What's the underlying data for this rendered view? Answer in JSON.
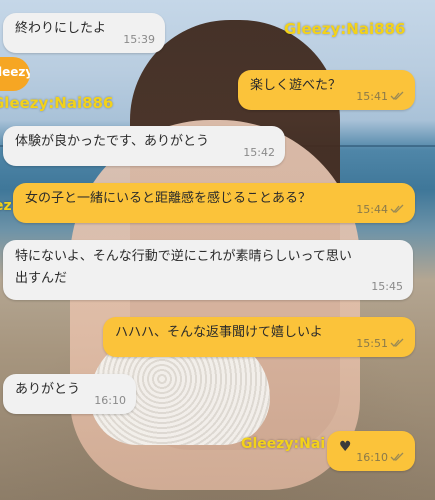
{
  "watermark": {
    "text": "Gleezy:Nai886",
    "partial": "Gleezy:Nai",
    "logo": "leezy",
    "side": "ez"
  },
  "messages": [
    {
      "dir": "in",
      "text": "終わりにしたよ",
      "time": "15:39",
      "read": false
    },
    {
      "dir": "out",
      "text": "楽しく遊べた？",
      "time": "15:41",
      "read": true
    },
    {
      "dir": "in",
      "text": "体験が良かったです、ありがとう",
      "time": "15:42",
      "read": false
    },
    {
      "dir": "out",
      "text": "女の子と一緒にいると距離感を感じることある？",
      "time": "15:44",
      "read": true
    },
    {
      "dir": "in",
      "text_line1": "特にないよ、そんな行動で逆にこれが素晴らしいって思い",
      "text_line2": "出すんだ",
      "time": "15:45",
      "read": false
    },
    {
      "dir": "out",
      "text": "ハハハ、そんな返事聞けて嬉しいよ",
      "time": "15:51",
      "read": true
    },
    {
      "dir": "in",
      "text": "ありがとう",
      "time": "16:10",
      "read": false
    },
    {
      "dir": "out",
      "text": "♥",
      "time": "16:10",
      "read": true
    }
  ],
  "colors": {
    "incoming_bubble": "#f1f1f1",
    "outgoing_bubble": "#fbc33a",
    "watermark": "#f3d21a",
    "read_ticks": "#9a8a55"
  }
}
